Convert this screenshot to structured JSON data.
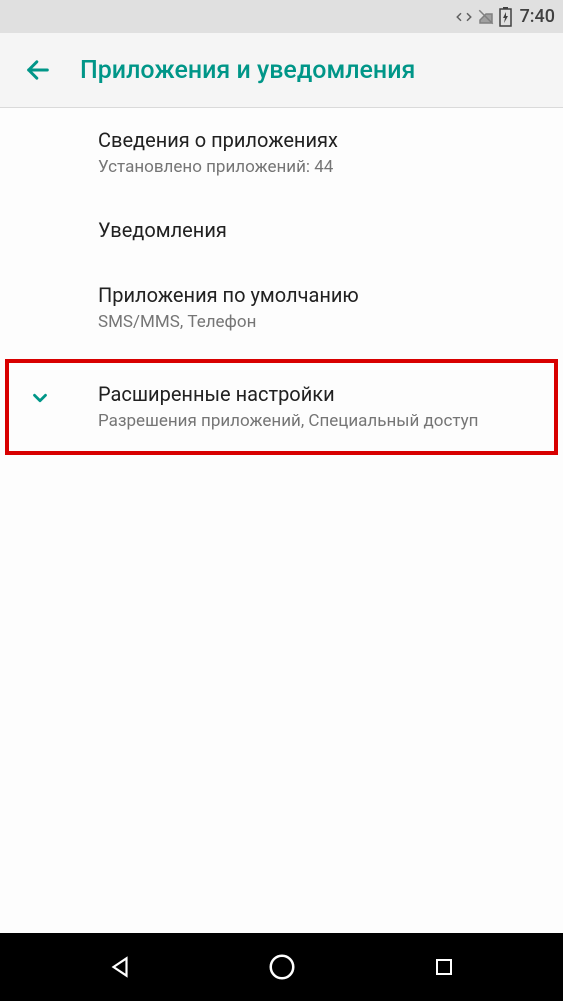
{
  "status_bar": {
    "time": "7:40"
  },
  "app_bar": {
    "title": "Приложения и уведомления"
  },
  "items": [
    {
      "title": "Сведения о приложениях",
      "subtitle": "Установлено приложений: 44"
    },
    {
      "title": "Уведомления",
      "subtitle": ""
    },
    {
      "title": "Приложения по умолчанию",
      "subtitle": "SMS/MMS, Телефон"
    }
  ],
  "advanced": {
    "title": "Расширенные настройки",
    "subtitle": "Разрешения приложений, Специальный доступ"
  }
}
